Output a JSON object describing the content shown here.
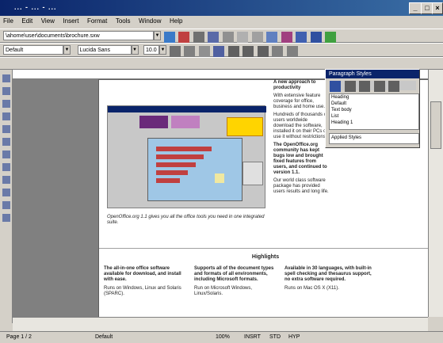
{
  "window": {
    "title": "... - ... - ..."
  },
  "menu": [
    "File",
    "Edit",
    "View",
    "Insert",
    "Format",
    "Tools",
    "Window",
    "Help"
  ],
  "toolbar": {
    "file_path": "\\ahome\\user\\documents\\brochure.sxw",
    "style_combo": "Default",
    "font_combo": "Lucida Sans",
    "size_combo": "10.0"
  },
  "styles_window": {
    "title": "Paragraph Styles",
    "items": [
      "Heading",
      "Default",
      "Text body",
      "List",
      "Heading 1"
    ],
    "filter": "Applied Styles"
  },
  "document": {
    "right_col": [
      {
        "text": "A new approach to productivity",
        "bold": true
      },
      {
        "text": "With extensive feature coverage for office, business and home use.",
        "bold": false
      },
      {
        "text": "Hundreds of thousands of users worldwide download the software, installed it on their PCs or use it without restrictions.",
        "bold": false
      },
      {
        "text": "The OpenOffice.org community has kept bugs low and brought fixed features from users, and continued to version 1.1.",
        "bold": true
      },
      {
        "text": "Our world class software package has provided users results and long life.",
        "bold": false
      }
    ],
    "caption": "OpenOffice.org 1.1 gives you all the office tools you need in one integrated suite.",
    "highlights_title": "Highlights",
    "highlights": [
      {
        "head": "The all-in-one office software available for download, and install with ease.",
        "sub": "Runs on Windows, Linux and Solaris (SPARC)."
      },
      {
        "head": "Supports all of the document types and formats of all environments, including Microsoft formats.",
        "sub": "Run on Microsoft Windows, Linux/Solaris."
      },
      {
        "head": "Available in 30 languages, with built-in spell checking and thesaurus support, no extra software required.",
        "sub": "Runs on Mac OS X (X11)."
      }
    ]
  },
  "status": {
    "page": "Page 1 / 2",
    "style": "Default",
    "zoom": "100%",
    "mode": "INSRT",
    "std": "STD",
    "hyp": "HYP"
  },
  "colors": {
    "titlebar": "#0a246a",
    "chart_bg": "#9fc7e6",
    "callout": "#ffd400"
  }
}
